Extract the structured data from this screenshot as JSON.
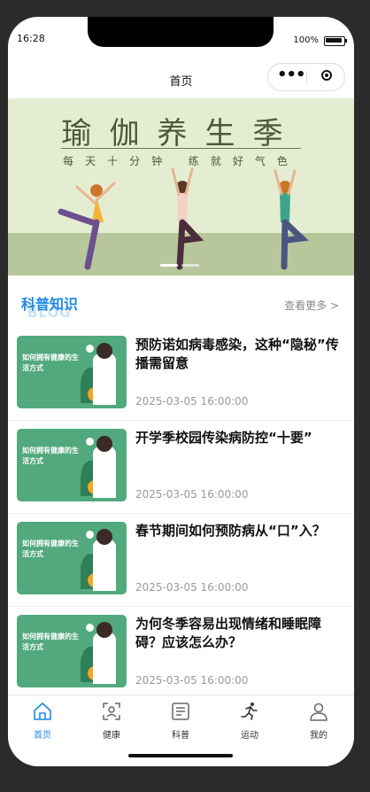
{
  "status": {
    "time": "16:28",
    "battery": "100%"
  },
  "navbar": {
    "title": "首页"
  },
  "banner": {
    "title": "瑜伽养生季",
    "subtitle": "每天十分钟 练就好气色"
  },
  "section": {
    "title": "科普知识",
    "watermark": "BLOG",
    "more": "查看更多 >"
  },
  "articles": [
    {
      "title": "预防诺如病毒感染，这种“隐秘”传播需留意",
      "date": "2025-03-05 16:00:00",
      "thumb_text": "如何拥有健康的生活方式"
    },
    {
      "title": "开学季校园传染病防控“十要”",
      "date": "2025-03-05 16:00:00",
      "thumb_text": "如何拥有健康的生活方式"
    },
    {
      "title": "春节期间如何预防病从“口”入？",
      "date": "2025-03-05 16:00:00",
      "thumb_text": "如何拥有健康的生活方式"
    },
    {
      "title": "为何冬季容易出现情绪和睡眠障碍？应该怎么办？",
      "date": "2025-03-05 16:00:00",
      "thumb_text": "如何拥有健康的生活方式"
    }
  ],
  "tabbar": [
    {
      "label": "首页",
      "icon": "home-icon",
      "active": true
    },
    {
      "label": "健康",
      "icon": "face-scan-icon",
      "active": false
    },
    {
      "label": "科普",
      "icon": "newspaper-icon",
      "active": false
    },
    {
      "label": "运动",
      "icon": "running-icon",
      "active": false
    },
    {
      "label": "我的",
      "icon": "user-icon",
      "active": false
    }
  ],
  "colors": {
    "accent": "#1e88e5",
    "banner_bg": "#e4edd2",
    "thumb_bg": "#52a97e"
  }
}
